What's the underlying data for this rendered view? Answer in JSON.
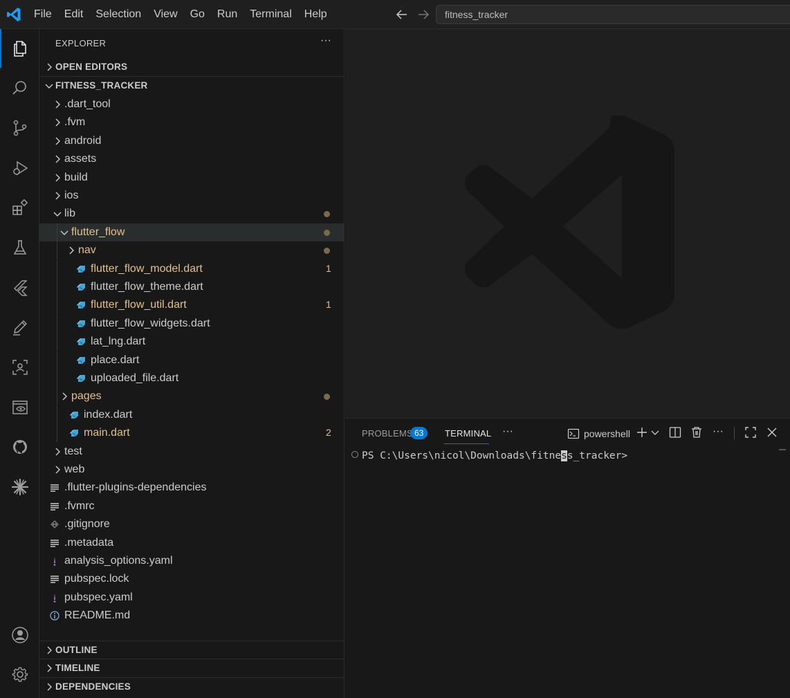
{
  "menu": [
    "File",
    "Edit",
    "Selection",
    "View",
    "Go",
    "Run",
    "Terminal",
    "Help"
  ],
  "search": {
    "value": "fitness_tracker"
  },
  "activity_bar": {
    "items": [
      "explorer-icon",
      "search-icon",
      "source-control-icon",
      "run-debug-icon",
      "extensions-icon",
      "testing-icon",
      "flutter-icon",
      "edit-icon",
      "scan-icon",
      "preview-icon",
      "github-icon",
      "asterisk-icon"
    ],
    "bottom": [
      "account-icon",
      "settings-gear-icon"
    ]
  },
  "sidebar": {
    "title": "EXPLORER",
    "more": "···",
    "sections": {
      "open_editors": "OPEN EDITORS",
      "project": "FITNESS_TRACKER",
      "outline": "OUTLINE",
      "timeline": "TIMELINE",
      "dependencies": "DEPENDENCIES"
    },
    "tree": [
      {
        "name": ".dart_tool",
        "type": "folder",
        "level": 0,
        "expanded": false
      },
      {
        "name": ".fvm",
        "type": "folder",
        "level": 0,
        "expanded": false
      },
      {
        "name": "android",
        "type": "folder",
        "level": 0,
        "expanded": false
      },
      {
        "name": "assets",
        "type": "folder",
        "level": 0,
        "expanded": false
      },
      {
        "name": "build",
        "type": "folder",
        "level": 0,
        "expanded": false
      },
      {
        "name": "ios",
        "type": "folder",
        "level": 0,
        "expanded": false
      },
      {
        "name": "lib",
        "type": "folder",
        "level": 0,
        "expanded": true,
        "dot": true
      },
      {
        "name": "flutter_flow",
        "type": "folder",
        "level": 1,
        "expanded": true,
        "dot": true,
        "modified": true,
        "selected": true
      },
      {
        "name": "nav",
        "type": "folder",
        "level": 2,
        "expanded": false,
        "dot": true,
        "modified": true
      },
      {
        "name": "flutter_flow_model.dart",
        "type": "dart",
        "level": 2,
        "modified": true,
        "badge": "1"
      },
      {
        "name": "flutter_flow_theme.dart",
        "type": "dart",
        "level": 2
      },
      {
        "name": "flutter_flow_util.dart",
        "type": "dart",
        "level": 2,
        "modified": true,
        "badge": "1"
      },
      {
        "name": "flutter_flow_widgets.dart",
        "type": "dart",
        "level": 2
      },
      {
        "name": "lat_lng.dart",
        "type": "dart",
        "level": 2
      },
      {
        "name": "place.dart",
        "type": "dart",
        "level": 2
      },
      {
        "name": "uploaded_file.dart",
        "type": "dart",
        "level": 2
      },
      {
        "name": "pages",
        "type": "folder",
        "level": 1,
        "expanded": false,
        "dot": true,
        "modified": true
      },
      {
        "name": "index.dart",
        "type": "dart",
        "level": 1
      },
      {
        "name": "main.dart",
        "type": "dart",
        "level": 1,
        "modified": true,
        "badge": "2"
      },
      {
        "name": "test",
        "type": "folder",
        "level": 0,
        "expanded": false
      },
      {
        "name": "web",
        "type": "folder",
        "level": 0,
        "expanded": false
      },
      {
        "name": ".flutter-plugins-dependencies",
        "type": "lines",
        "level": 0
      },
      {
        "name": ".fvmrc",
        "type": "lines",
        "level": 0
      },
      {
        "name": ".gitignore",
        "type": "git",
        "level": 0
      },
      {
        "name": ".metadata",
        "type": "lines",
        "level": 0
      },
      {
        "name": "analysis_options.yaml",
        "type": "yaml",
        "level": 0
      },
      {
        "name": "pubspec.lock",
        "type": "lines",
        "level": 0
      },
      {
        "name": "pubspec.yaml",
        "type": "yaml",
        "level": 0
      },
      {
        "name": "README.md",
        "type": "info",
        "level": 0
      }
    ]
  },
  "panel": {
    "tabs": {
      "problems": "PROBLEMS",
      "problems_count": "63",
      "terminal": "TERMINAL",
      "more": "···"
    },
    "shell": "powershell",
    "terminal": {
      "before_cursor": "PS C:\\Users\\nicol\\Downloads\\fitne",
      "cursor_char": "s",
      "after_cursor": "s_tracker>"
    }
  },
  "colors": {
    "accent": "#0078d4",
    "modified": "#e2c08d",
    "dart": "#42a5d8",
    "yaml": "#b180d7"
  }
}
